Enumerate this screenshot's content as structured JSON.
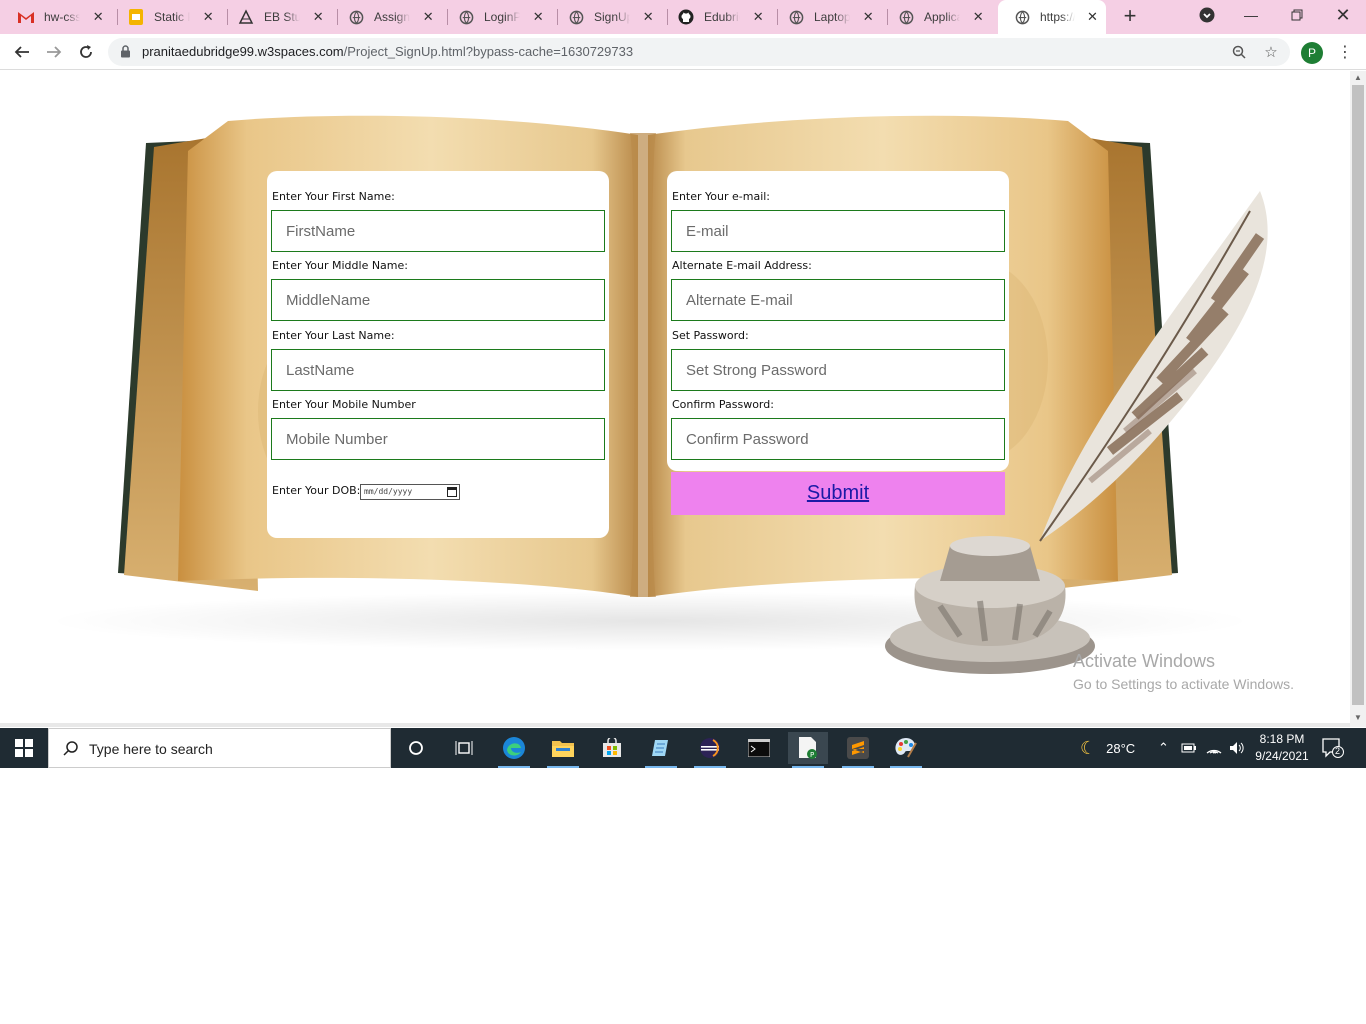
{
  "browser": {
    "tabs": [
      {
        "title": "hw-css-f",
        "icon": "gmail-icon"
      },
      {
        "title": "Static Pro",
        "icon": "slides-icon"
      },
      {
        "title": "EB Stude",
        "icon": "edubridge-icon"
      },
      {
        "title": "Assignm",
        "icon": "globe-icon"
      },
      {
        "title": "LoginPa",
        "icon": "globe-icon"
      },
      {
        "title": "SignUpP",
        "icon": "globe-icon"
      },
      {
        "title": "Edubridg",
        "icon": "github-icon"
      },
      {
        "title": "Laptop_",
        "icon": "globe-icon"
      },
      {
        "title": "Applicat",
        "icon": "globe-icon"
      },
      {
        "title": "https://p",
        "icon": "globe-icon"
      }
    ],
    "url_host": "pranitaedubridge99.w3spaces.com",
    "url_rest": "/Project_SignUp.html?bypass-cache=1630729733",
    "profile_initial": "P"
  },
  "form": {
    "first_name_label": "Enter Your First Name:",
    "first_name_placeholder": "FirstName",
    "middle_name_label": "Enter Your Middle Name:",
    "middle_name_placeholder": "MiddleName",
    "last_name_label": "Enter Your Last Name:",
    "last_name_placeholder": "LastName",
    "mobile_label": "Enter Your Mobile Number",
    "mobile_placeholder": "Mobile Number",
    "dob_label": "Enter Your DOB:",
    "dob_placeholder": "mm/dd/yyyy",
    "email_label": "Enter Your e-mail:",
    "email_placeholder": "E-mail",
    "alt_email_label": "Alternate E-mail Address:",
    "alt_email_placeholder": "Alternate E-mail",
    "password_label": "Set Password:",
    "password_placeholder": "Set Strong Password",
    "confirm_label": "Confirm Password:",
    "confirm_placeholder": "Confirm Password",
    "submit_label": "Submit"
  },
  "watermark": {
    "title": "Activate Windows",
    "subtitle": "Go to Settings to activate Windows."
  },
  "taskbar": {
    "search_placeholder": "Type here to search",
    "weather": "28°C",
    "time": "8:18 PM",
    "date": "9/24/2021",
    "notification_count": "2"
  },
  "colors": {
    "tabstrip": "#f5cfe4",
    "field_border": "#1c7a1c",
    "submit_bg": "#ee82ee",
    "taskbar": "#1f2b33"
  }
}
